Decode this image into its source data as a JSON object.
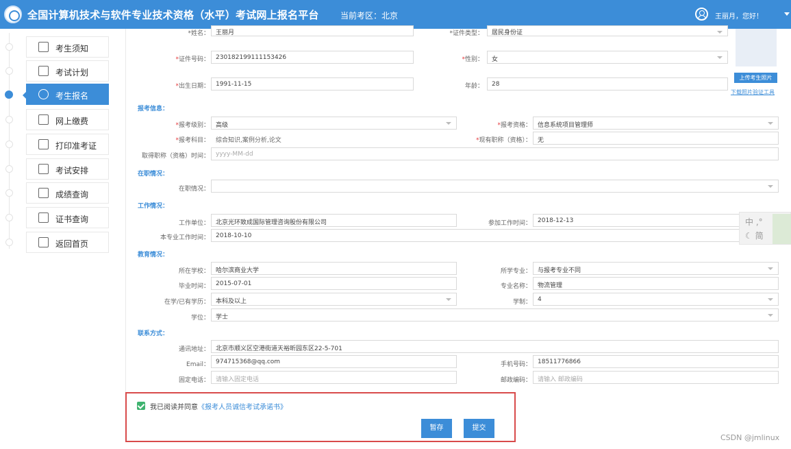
{
  "header": {
    "title": "全国计算机技术与软件专业技术资格（水平）考试网上报名平台",
    "region": "当前考区：北京",
    "greeting": "王丽月，您好！"
  },
  "sidebar": {
    "items": [
      {
        "label": "考生须知",
        "icon": "notice-icon"
      },
      {
        "label": "考试计划",
        "icon": "schedule-icon"
      },
      {
        "label": "考生报名",
        "icon": "clock-icon",
        "active": true
      },
      {
        "label": "网上缴费",
        "icon": "payment-icon"
      },
      {
        "label": "打印准考证",
        "icon": "printer-icon"
      },
      {
        "label": "考试安排",
        "icon": "arrangement-icon"
      },
      {
        "label": "成绩查询",
        "icon": "search-icon"
      },
      {
        "label": "证书查询",
        "icon": "certificate-icon"
      },
      {
        "label": "返回首页",
        "icon": "home-icon"
      }
    ]
  },
  "personal": {
    "name_label": "*姓名：",
    "name": "王丽月",
    "idtype_label": "*证件类型：",
    "idtype": "居民身份证",
    "idno_label": "*证件号码：",
    "idno": "230182199111153426",
    "gender_label": "*性别：",
    "gender": "女",
    "birth_label": "*出生日期：",
    "birth": "1991-11-15",
    "age_label": "年龄：",
    "age": "28",
    "upload_label": "上传考生照片",
    "download_label": "下载照片验证工具"
  },
  "exam": {
    "section": "报考信息：",
    "level_label": "*报考级别：",
    "level": "高级",
    "qual_label": "*报考资格：",
    "qual": "信息系统项目管理师",
    "subject_label": "*报考科目：",
    "subject": "综合知识,案例分析,论文",
    "title_label": "*现有职称（资格）：",
    "title": "无",
    "title_time_label": "取得职称（资格）时间：",
    "title_time_ph": "yyyy-MM-dd"
  },
  "employment": {
    "section": "在职情况：",
    "status_label": "在职情况：",
    "status": ""
  },
  "work": {
    "section": "工作情况：",
    "unit_label": "工作单位：",
    "unit": "北京光环致成国际管理咨询股份有限公司",
    "start_label": "参加工作时间：",
    "start": "2018-12-13",
    "major_time_label": "本专业工作时间：",
    "major_time": "2018-10-10"
  },
  "edu": {
    "section": "教育情况：",
    "school_label": "所在学校：",
    "school": "哈尔滨商业大学",
    "major_rel_label": "所学专业：",
    "major_rel": "与报考专业不同",
    "grad_label": "毕业时间：",
    "grad": "2015-07-01",
    "major_label": "专业名称：",
    "major": "物流管理",
    "degree_level_label": "在学/已有学历：",
    "degree_level": "本科及以上",
    "years_label": "学制：",
    "years": "4",
    "degree_label": "学位：",
    "degree": "学士"
  },
  "contact": {
    "section": "联系方式：",
    "address_label": "通讯地址：",
    "address": "北京市顺义区空港街道天裕昕园东区22-5-701",
    "email_label": "Email：",
    "email": "974715368@qq.com",
    "mobile_label": "手机号码：",
    "mobile": "18511776866",
    "phone_label": "固定电话：",
    "phone_ph": "请输入固定电话",
    "zip_label": "邮政编码：",
    "zip_ph": "请输入 邮政编码"
  },
  "agreement": {
    "text": "我已阅读并同意",
    "link": "《报考人员诚信考试承诺书》"
  },
  "actions": {
    "save": "暂存",
    "submit": "提交"
  },
  "ime": {
    "zh": "中 ,°",
    "jian": "☾ 简"
  },
  "watermark": "CSDN @jmlinux"
}
